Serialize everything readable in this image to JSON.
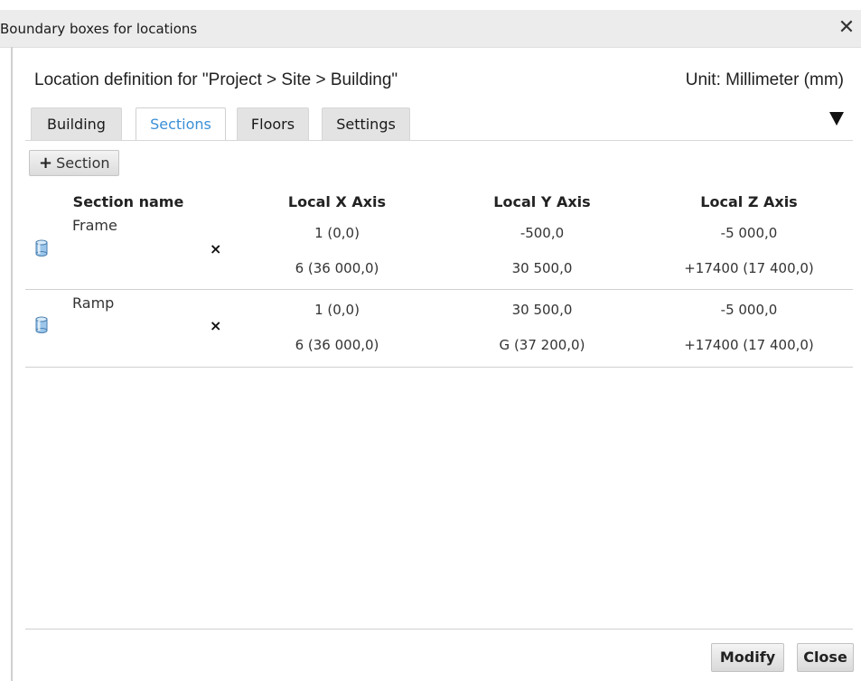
{
  "window": {
    "title": "Boundary boxes for locations",
    "close_glyph": "✕"
  },
  "header": {
    "location_definition": "Location definition for \"Project > Site > Building\"",
    "unit": "Unit: Millimeter (mm)"
  },
  "tabs": [
    {
      "label": "Building",
      "active": false
    },
    {
      "label": "Sections",
      "active": true
    },
    {
      "label": "Floors",
      "active": false
    },
    {
      "label": "Settings",
      "active": false
    }
  ],
  "toolbar": {
    "add_section_icon": "plus-icon",
    "add_section_label": "Section"
  },
  "table": {
    "columns": [
      "Section name",
      "Local X Axis",
      "Local Y Axis",
      "Local Z Axis"
    ],
    "delete_glyph": "×",
    "rows": [
      {
        "name": "Frame",
        "x": [
          "1 (0,0)",
          "6 (36 000,0)"
        ],
        "y": [
          "-500,0",
          "30 500,0"
        ],
        "z": [
          "-5 000,0",
          "+17400 (17 400,0)"
        ]
      },
      {
        "name": "Ramp",
        "x": [
          "1 (0,0)",
          "6 (36 000,0)"
        ],
        "y": [
          "30 500,0",
          "G (37 200,0)"
        ],
        "z": [
          "-5 000,0",
          "+17400 (17 400,0)"
        ]
      }
    ]
  },
  "footer": {
    "modify_label": "Modify",
    "close_label": "Close"
  },
  "colors": {
    "active_tab": "#3a8fd6",
    "icon_blue": "#7fb4e0"
  }
}
